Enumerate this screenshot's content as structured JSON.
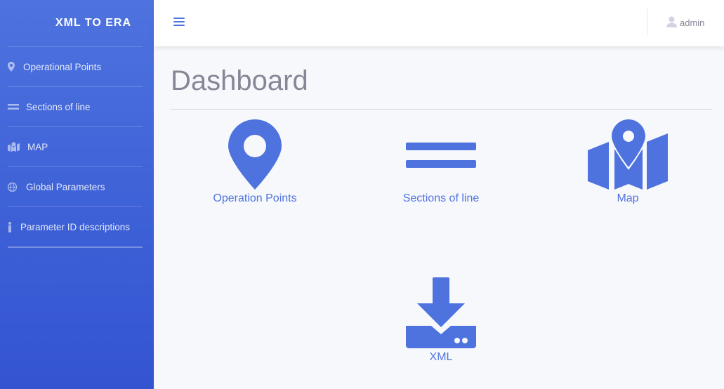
{
  "sidebar": {
    "brand": "XML TO ERA",
    "items": [
      {
        "label": "Operational Points",
        "icon": "map-marker-icon"
      },
      {
        "label": "Sections of line",
        "icon": "equals-icon"
      },
      {
        "label": "MAP",
        "icon": "map-icon"
      },
      {
        "label": "Global Parameters",
        "icon": "globe-icon"
      },
      {
        "label": "Parameter ID descriptions",
        "icon": "info-icon"
      }
    ]
  },
  "topbar": {
    "user_label": "admin"
  },
  "main": {
    "title": "Dashboard",
    "tiles": [
      {
        "label": "Operation Points",
        "icon": "map-marker-icon"
      },
      {
        "label": "Sections of line",
        "icon": "equals-icon"
      },
      {
        "label": "Map",
        "icon": "map-icon"
      },
      {
        "label": "XML",
        "icon": "download-icon"
      }
    ]
  },
  "colors": {
    "primary": "#4e73df",
    "sidebar_gradient_end": "#3454d1",
    "muted_text": "#858796",
    "background": "#f7f8fc"
  }
}
